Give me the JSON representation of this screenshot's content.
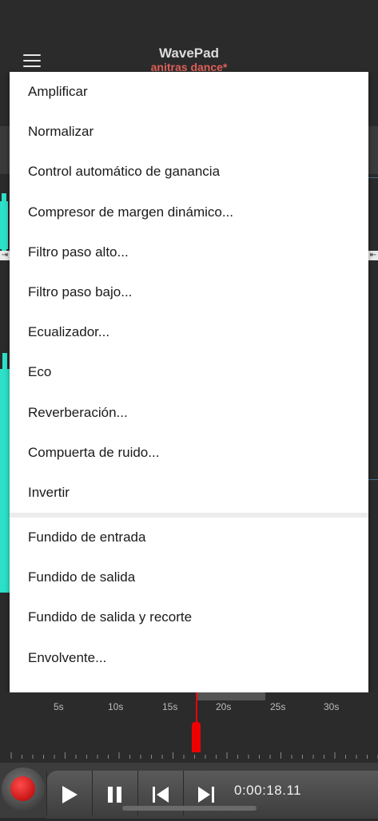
{
  "header": {
    "app_title": "WavePad",
    "file_title": "anitras dance*"
  },
  "menu": {
    "items_group1": [
      "Amplificar",
      "Normalizar",
      "Control automático de ganancia",
      "Compresor de margen dinámico...",
      "Filtro paso alto...",
      "Filtro paso bajo...",
      "Ecualizador...",
      "Eco",
      "Reverberación...",
      "Compuerta de ruido...",
      "Invertir"
    ],
    "items_group2": [
      "Fundido de entrada",
      "Fundido de salida",
      "Fundido de salida y recorte",
      "Envolvente..."
    ]
  },
  "timeline": {
    "ticks": [
      "5s",
      "10s",
      "15s",
      "20s",
      "25s",
      "30s"
    ]
  },
  "transport": {
    "time": "0:00:18.11"
  },
  "colors": {
    "accent_red": "#e00000",
    "file_title": "#e0605a",
    "waveform": "#2de0c8"
  }
}
